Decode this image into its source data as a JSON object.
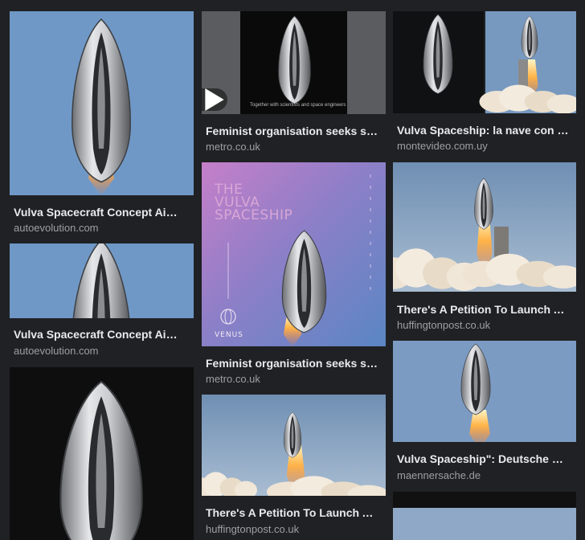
{
  "results": [
    {
      "title": "Vulva Spacecraft Concept Aims To Help Fight Gender Inequality in Space",
      "source": "autoevolution.com"
    },
    {
      "title": "Vulva Spacecraft Concept Aims To Help Fight Gender Inequality in Space",
      "source": "autoevolution.com"
    },
    {
      "title": "Feminist organisation seeks support for vulva spaceship",
      "source": "metro.co.uk",
      "video_caption": "Together with scientists and space engineers",
      "has_video": true
    },
    {
      "title": "Feminist organisation seeks support for vulva spaceship",
      "source": "metro.co.uk",
      "poster_title": "THE\nVULVA\nSPACESHIP",
      "poster_brand": "VENUS"
    },
    {
      "title": "There's A Petition To Launch A Vulva Spaceship",
      "source": "huffingtonpost.co.uk"
    },
    {
      "title": "Vulva Spaceship: la nave con forma de vulva",
      "source": "montevideo.com.uy"
    },
    {
      "title": "There's A Petition To Launch A Vulva Spaceship",
      "source": "huffingtonpost.co.uk"
    },
    {
      "title": "Vulva Spaceship\": Deutsche Feministinnen wollen in den Weltraum",
      "source": "maennersache.de"
    }
  ],
  "colors": {
    "background": "#202124",
    "title": "#e8eaed",
    "source": "#9aa0a6"
  }
}
